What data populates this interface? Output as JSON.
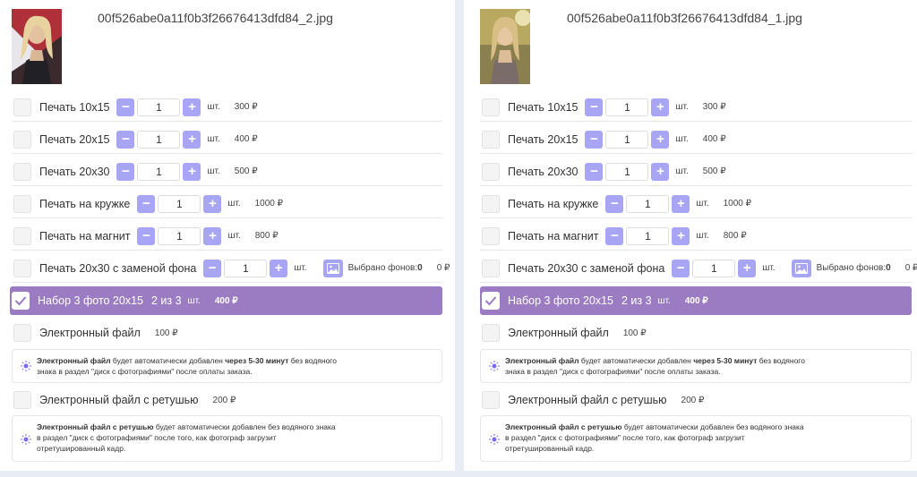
{
  "items": {
    "p10x15": "Печать 10x15",
    "p20x15": "Печать 20x15",
    "p20x30": "Печать 20x30",
    "mug": "Печать на кружке",
    "magnet": "Печать на магнит",
    "p20x30_bg": "Печать 20x30 с заменой фона",
    "set": "Набор 3 фото 20x15",
    "efile": "Электронный файл",
    "efile_ret": "Электронный файл с ретушью"
  },
  "prices": {
    "p10x15": "300 ₽",
    "p20x15": "400 ₽",
    "p20x30": "500 ₽",
    "mug": "1000 ₽",
    "magnet": "800 ₽",
    "bg_selected": "0 ₽",
    "set": "400 ₽",
    "efile": "100 ₽",
    "efile_ret": "200 ₽"
  },
  "quantity": "1",
  "unit": "шт.",
  "set_count": "2 из 3",
  "bg_picker": {
    "label": "Выбрано фонов:",
    "count": "0"
  },
  "info_efile": {
    "bold": "Электронный файл",
    "middle": " будет автоматически добавлен ",
    "bold2": "через 5-30 минут",
    "rest": " без водяного знака в раздел \"диск с фотографиями\" после оплаты заказа."
  },
  "info_efile_ret": {
    "bold": "Электронный файл с ретушью",
    "rest": " будет автоматически добавлен без водяного знака в раздел \"диск с фотографиями\" после того, как фотограф загрузит отретушированный кадр."
  },
  "cards": [
    {
      "filename": "00f526abe0a11f0b3f26676413dfd84_2.jpg"
    },
    {
      "filename": "00f526abe0a11f0b3f26676413dfd84_1.jpg"
    }
  ],
  "colors": {
    "accent": "#a8a6f4",
    "selected_row": "#9b7cc3",
    "background": "#e8edf5"
  }
}
